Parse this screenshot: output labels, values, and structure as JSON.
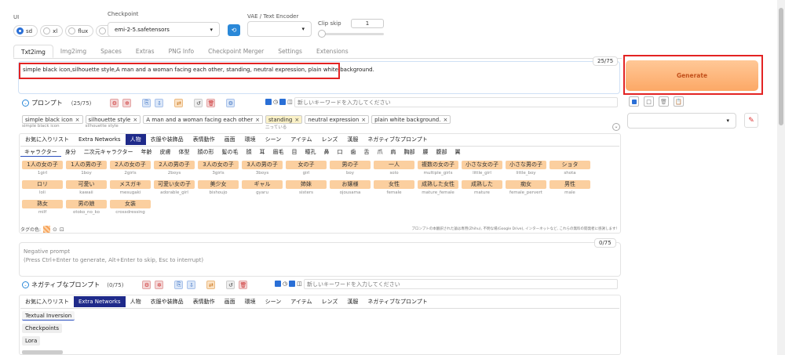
{
  "top": {
    "ui_label": "UI",
    "ui_options": [
      "sd",
      "xl",
      "flux",
      "all"
    ],
    "ui_selected": "sd",
    "checkpoint_label": "Checkpoint",
    "checkpoint_value": "emi-2-5.safetensors",
    "vae_label": "VAE / Text Encoder",
    "vae_value": "",
    "clip_skip_label": "Clip skip",
    "clip_skip_value": "1"
  },
  "tabs": [
    "Txt2img",
    "Img2img",
    "Spaces",
    "Extras",
    "PNG Info",
    "Checkpoint Merger",
    "Settings",
    "Extensions"
  ],
  "active_tab": "Txt2img",
  "prompt": {
    "text": "simple  black  icon,silhouette  style,A man and a woman facing each other, standing, neutral expression, plain white background.",
    "counter": "25/75",
    "title": "プロンプト",
    "count": "(25/75)",
    "new_keyword_placeholder": "新しいキーワードを入力してください"
  },
  "prompt_chips": [
    {
      "text": "simple  black  icon",
      "sub": "simple  black  icon",
      "hl": false
    },
    {
      "text": "silhouette  style",
      "sub": "silhouette  style",
      "hl": false
    },
    {
      "text": "A man and a woman facing each other",
      "sub": "",
      "hl": false
    },
    {
      "text": "standing",
      "sub": "二っている",
      "hl": true
    },
    {
      "text": "neutral expression",
      "sub": "",
      "hl": false
    },
    {
      "text": "plain white background.",
      "sub": "",
      "hl": false
    }
  ],
  "categories": [
    "お気に入りリスト",
    "Extra Networks",
    "人物",
    "衣服や装飾品",
    "表情動作",
    "画面",
    "環境",
    "シーン",
    "アイテム",
    "レンズ",
    "漢服",
    "ネガティブなプロンプト"
  ],
  "active_category": "人物",
  "subcategories": [
    "キャラクター",
    "身分",
    "二次元キャラクター",
    "年齢",
    "皮膚",
    "体型",
    "顔の形",
    "髪の毛",
    "顔",
    "耳",
    "眉毛",
    "目",
    "瞳孔",
    "鼻",
    "口",
    "歯",
    "舌",
    "爪",
    "肩",
    "胸部",
    "腰",
    "腹部",
    "翼"
  ],
  "tags": [
    {
      "j": "1人の女の子",
      "e": "1girl"
    },
    {
      "j": "1人の男の子",
      "e": "1boy"
    },
    {
      "j": "2人の女の子",
      "e": "2girls"
    },
    {
      "j": "2人の男の子",
      "e": "2boys"
    },
    {
      "j": "3人の女の子",
      "e": "3girls"
    },
    {
      "j": "3人の男の子",
      "e": "3boys"
    },
    {
      "j": "女の子",
      "e": "girl"
    },
    {
      "j": "男の子",
      "e": "boy"
    },
    {
      "j": "一人",
      "e": "solo"
    },
    {
      "j": "複数の女の子",
      "e": "multiple_girls"
    },
    {
      "j": "小さな女の子",
      "e": "little_girl"
    },
    {
      "j": "小さな男の子",
      "e": "little_boy"
    },
    {
      "j": "ショタ",
      "e": "shota"
    },
    {
      "j": "ロリ",
      "e": "loli"
    },
    {
      "j": "可愛い",
      "e": "kawaii"
    },
    {
      "j": "メスガキ",
      "e": "mesugaki"
    },
    {
      "j": "可愛い女の子",
      "e": "adorable_girl"
    },
    {
      "j": "美少女",
      "e": "bishoujo"
    },
    {
      "j": "ギャル",
      "e": "gyaru"
    },
    {
      "j": "姉妹",
      "e": "sisters"
    },
    {
      "j": "お嬢様",
      "e": "ojousama"
    },
    {
      "j": "女性",
      "e": "female"
    },
    {
      "j": "成熟した女性",
      "e": "mature_female"
    },
    {
      "j": "成熟した",
      "e": "mature"
    },
    {
      "j": "痴女",
      "e": "female_pervert"
    },
    {
      "j": "男性",
      "e": "male"
    },
    {
      "j": "熟女",
      "e": "milf"
    },
    {
      "j": "男の娘",
      "e": "otoko_no_ko"
    },
    {
      "j": "女装",
      "e": "crossdressing"
    }
  ],
  "tag_color_label": "タグの色:",
  "disclaimer": "プロンプトの本翻訳された論は専用(Zhihu), 不明な場(Google Drive), インターネットなど, これらの無料の開発者に感謝します！",
  "negative": {
    "placeholder": "Negative prompt\n(Press Ctrl+Enter to generate, Alt+Enter to skip, Esc to interrupt)",
    "counter": "0/75",
    "title": "ネガティブなプロンプト",
    "count": "(0/75)",
    "new_keyword_placeholder": "新しいキーワードを入力してください"
  },
  "neg_categories": [
    "お気に入りリスト",
    "Extra Networks",
    "人物",
    "衣服や装飾品",
    "表情動作",
    "画面",
    "環境",
    "シーン",
    "アイテム",
    "レンズ",
    "漢服",
    "ネガティブなプロンプト"
  ],
  "neg_active_category": "Extra Networks",
  "extra_networks": [
    "Textual Inversion",
    "Checkpoints",
    "Lora"
  ],
  "generate_label": "Generate",
  "colors": {
    "accent": "#fca866",
    "highlight_frame": "#e32323",
    "active_cat": "#1f2a8a",
    "tag_bg": "#fbcf9f"
  }
}
